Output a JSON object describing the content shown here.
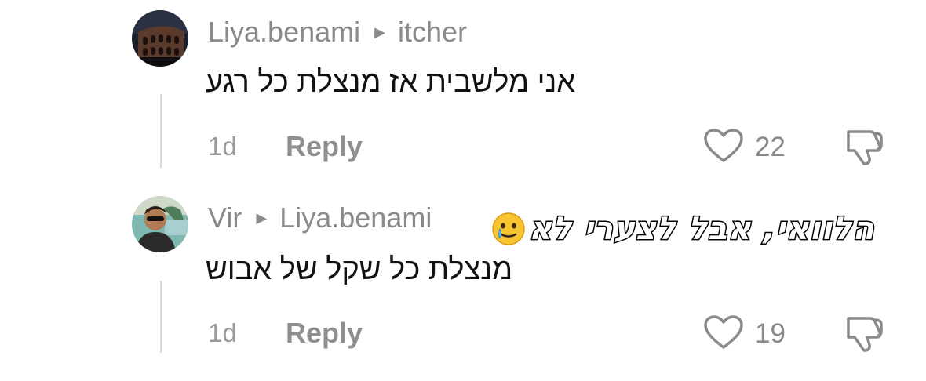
{
  "comments": [
    {
      "author": "Liya.benami",
      "reply_to": "itcher",
      "text": "אני מלשבית אז מנצלת כל רגע",
      "time": "1d",
      "reply_label": "Reply",
      "likes": "22",
      "avatar_icon": "colosseum-night-photo"
    },
    {
      "author": "Vir",
      "reply_to": "Liya.benami",
      "text": "מנצלת כל שקל של אבוש",
      "time": "1d",
      "reply_label": "Reply",
      "likes": "19",
      "avatar_icon": "man-sunglasses-photo"
    }
  ],
  "overlay": {
    "text": "הלוואי, אבל לצערי לא",
    "emoji": "crying-smile-emoji"
  },
  "colors": {
    "secondary_text": "#8a8a8a",
    "primary_text": "#111111",
    "thread_line": "#d9d9d9"
  }
}
